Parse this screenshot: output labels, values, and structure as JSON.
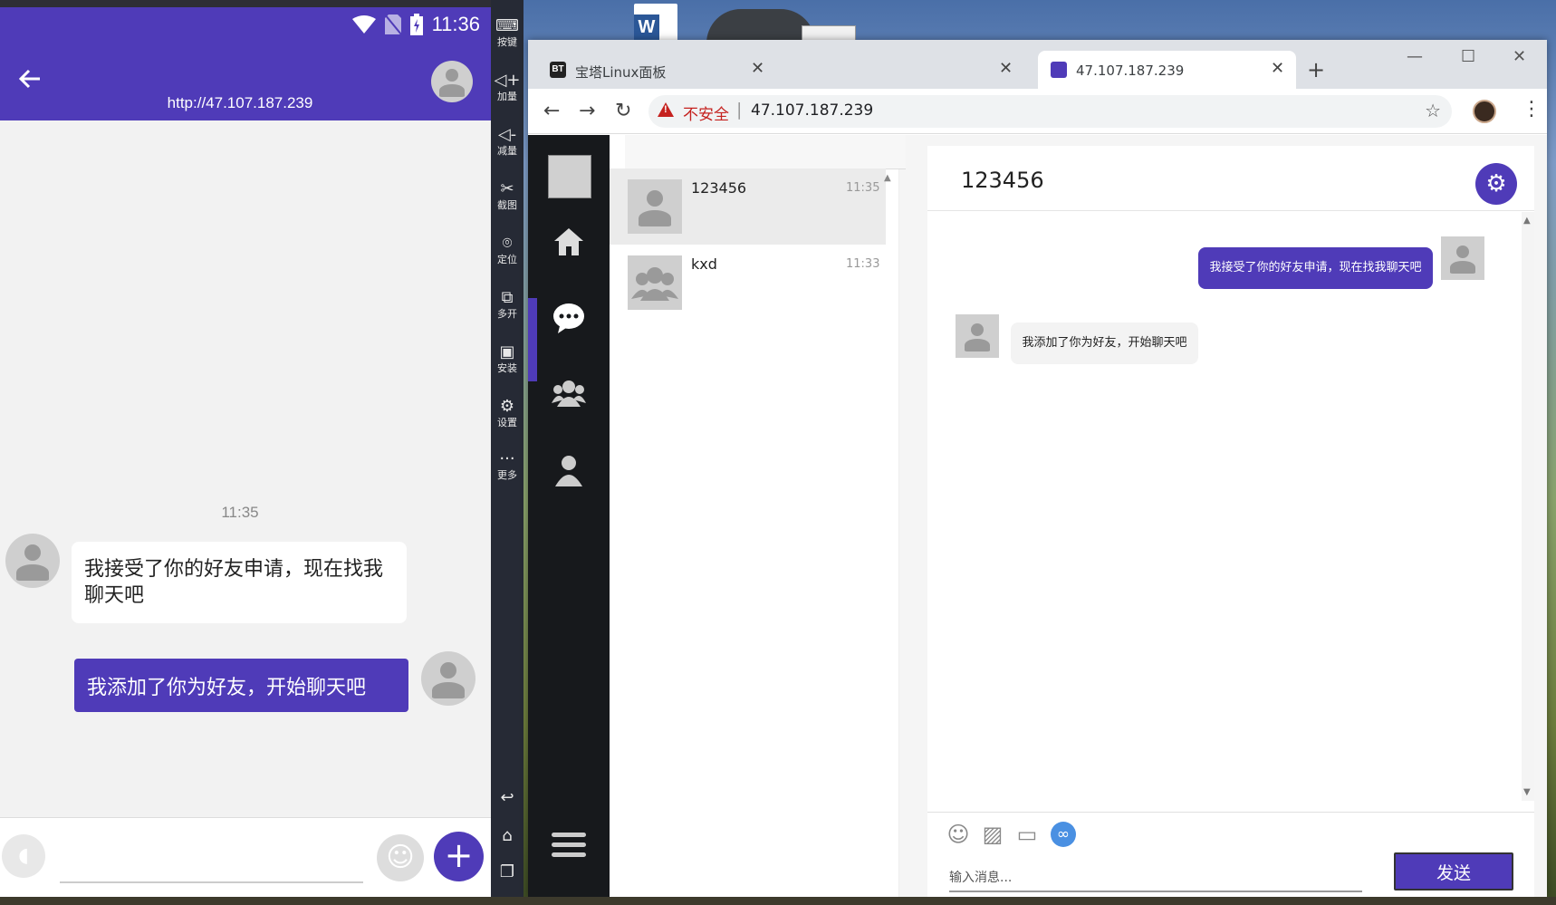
{
  "phone": {
    "status_time": "11:36",
    "header_url": "http://47.107.187.239",
    "timestamp": "11:35",
    "messages": [
      {
        "direction": "in",
        "text": "我接受了你的好友申请，现在找我聊天吧"
      },
      {
        "direction": "out",
        "text": "我添加了你为好友，开始聊天吧"
      }
    ],
    "accent_color": "#4f3bb8"
  },
  "emulator_toolbar": {
    "items": [
      {
        "icon": "keyboard-icon",
        "label": "按键"
      },
      {
        "icon": "volume-up-icon",
        "label": "加量"
      },
      {
        "icon": "volume-down-icon",
        "label": "减量"
      },
      {
        "icon": "scissors-icon",
        "label": "截图"
      },
      {
        "icon": "location-icon",
        "label": "定位"
      },
      {
        "icon": "multi-open-icon",
        "label": "多开"
      },
      {
        "icon": "apk-install-icon",
        "label": "安装"
      },
      {
        "icon": "gear-icon",
        "label": "设置"
      },
      {
        "icon": "more-icon",
        "label": "更多"
      }
    ]
  },
  "browser": {
    "tabs": [
      {
        "title": "宝塔Linux面板",
        "active": false
      },
      {
        "title": "",
        "active": false
      },
      {
        "title": "47.107.187.239",
        "active": true
      }
    ],
    "address": {
      "security_label": "不安全",
      "url": "47.107.187.239"
    }
  },
  "web_app": {
    "conversations": [
      {
        "name": "123456",
        "time": "11:35",
        "type": "person",
        "active": true
      },
      {
        "name": "kxd",
        "time": "11:33",
        "type": "group",
        "active": false
      }
    ],
    "chat": {
      "title": "123456",
      "messages": [
        {
          "direction": "out",
          "text": "我接受了你的好友申请，现在找我聊天吧"
        },
        {
          "direction": "in",
          "text": "我添加了你为好友，开始聊天吧"
        }
      ],
      "input_placeholder": "输入消息...",
      "send_label": "发送"
    },
    "accent_color": "#4f3bb8"
  }
}
